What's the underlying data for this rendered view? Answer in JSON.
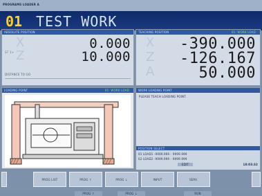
{
  "window_title": "PROGRAMS LOADER A",
  "header": {
    "program_no": "01",
    "program_name": "TEST WORK"
  },
  "absolute": {
    "title": "ABSOLUTE POSITION",
    "axes": [
      {
        "letter": "X",
        "value": "0.000"
      },
      {
        "letter": "Z",
        "value": "10.000"
      }
    ],
    "prefix": "ST 1>",
    "distance_label": "DISTANCE TO GO"
  },
  "teaching": {
    "title": "TEACHING POSITION",
    "tag": "01: WORK LOAD",
    "axes": [
      {
        "letter": "X",
        "value": "-390.000"
      },
      {
        "letter": "Z",
        "value": "-126.167"
      },
      {
        "letter": "A",
        "value": "50.000"
      }
    ]
  },
  "loading": {
    "title": "LOADING POINT",
    "tag": "01: WORK LOAD"
  },
  "work_loading": {
    "title": "WORK LOADING POINT",
    "message": "PLEASE TEACH LOADING POINT."
  },
  "position_select": {
    "title": "POSITION SELECT",
    "rows": [
      "01 LOAD1 -9999.999 - 9999.999",
      "02 LOAD2 -9999.999 - 9999.999"
    ],
    "status": "EDIT",
    "time": "18:03:32"
  },
  "softkeys": [
    "PROG LIST",
    "PROG ↑",
    "PROG ↓",
    "INPUT",
    "SERV."
  ],
  "subkeys": [
    "PROG ↑",
    "PROG ↓",
    "RUN"
  ],
  "colors": {
    "header_bg": "#0e2a6a",
    "prog_no": "#ffd21e",
    "panel_head": "#2d5aa3",
    "panel_tag": "#7bf07b"
  }
}
